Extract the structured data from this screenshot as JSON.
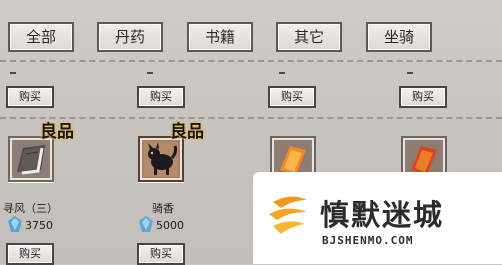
{
  "tabs": [
    {
      "label": "全部"
    },
    {
      "label": "丹药"
    },
    {
      "label": "书籍"
    },
    {
      "label": "其它"
    },
    {
      "label": "坐骑"
    }
  ],
  "row1": {
    "buy_labels": [
      "购买",
      "购买",
      "购买",
      "购买"
    ]
  },
  "items": [
    {
      "name": "寻风（三）",
      "price": "3750",
      "badge": "良品",
      "icon": "scroll-book-icon",
      "buy": "购买"
    },
    {
      "name": "骑香",
      "price": "5000",
      "badge": "良品",
      "icon": "black-beast-mount-icon",
      "buy": "购买"
    },
    {
      "name": "",
      "price": "",
      "badge": "",
      "icon": "orange-talisman-icon",
      "buy": ""
    },
    {
      "name": "",
      "price": "",
      "badge": "",
      "icon": "red-talisman-icon",
      "buy": ""
    }
  ],
  "colors": {
    "gem": "#5aa6d8",
    "background": "#c9c6c1",
    "watermark_orange": "#f29a1e"
  },
  "watermark": {
    "title": "慎默迷城",
    "url": "BJSHENMO.COM"
  }
}
